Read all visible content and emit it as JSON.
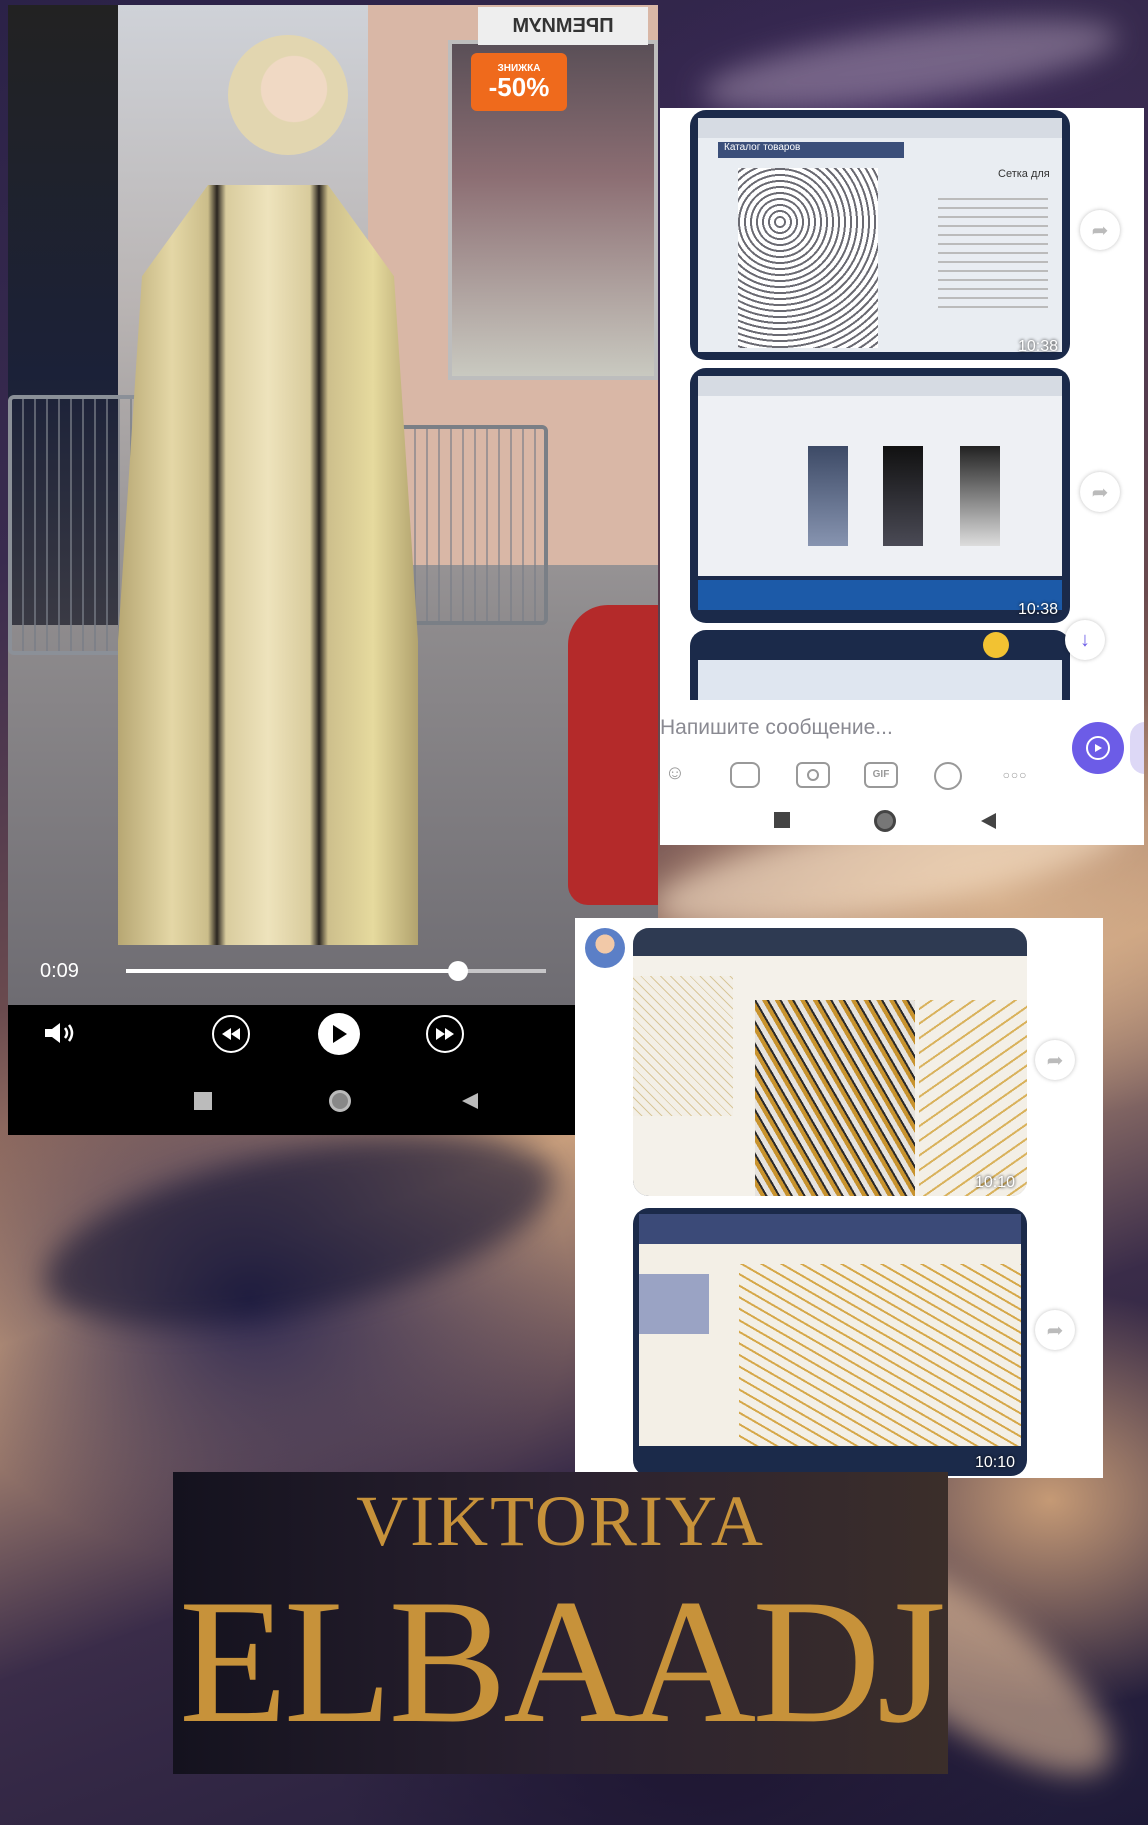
{
  "colors": {
    "accent_purple": "#6c5ce7",
    "brand_gold": "#c7923a",
    "store_sign_orange": "#ef6a1c"
  },
  "video_player": {
    "current_time": "0:09",
    "progress": 0.79,
    "store_sign": "ПРЕМИУМ",
    "store_sale": "-50%",
    "store_sale_prefix": "%",
    "store_sale_label": "ЗНИЖКА",
    "controls": {
      "volume_icon": "volume-icon",
      "rewind_icon": "rewind-icon",
      "play_icon": "play-icon",
      "forward_icon": "forward-icon"
    },
    "nav": [
      "square-icon",
      "circle-icon",
      "back-triangle-icon"
    ]
  },
  "chat_top": {
    "messages": [
      {
        "time": "10:38",
        "browser_label": "Каталог товаров",
        "product_title": "Сетка для"
      },
      {
        "time": "10:38"
      },
      {
        "time": ""
      }
    ],
    "input_placeholder": "Напишите сообщение...",
    "toolbar_icons": [
      "sticker-icon",
      "gallery-icon",
      "camera-icon",
      "gif-icon",
      "timer-icon",
      "more-icon"
    ],
    "send_icon": "send-icon",
    "scroll_down_icon": "arrow-down-icon",
    "nav": [
      "square-icon",
      "circle-icon",
      "back-triangle-icon"
    ]
  },
  "chat_bottom": {
    "messages": [
      {
        "time": "10:10"
      },
      {
        "time": "10:10"
      }
    ]
  },
  "brand": {
    "first_name": "VIKTORIYA",
    "last_name": "ELBAADJ"
  }
}
